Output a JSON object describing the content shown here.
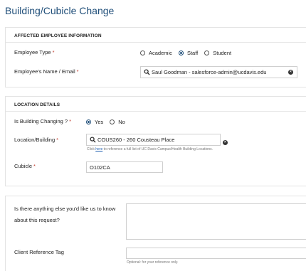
{
  "page": {
    "title": "Building/Cubicle Change"
  },
  "affected": {
    "heading": "AFFECTED EMPLOYEE INFORMATION",
    "employee_type": {
      "label": "Employee Type",
      "required": "*",
      "options": [
        "Academic",
        "Staff",
        "Student"
      ],
      "selected": "Staff"
    },
    "employee_name": {
      "label": "Employee's Name / Email",
      "required": "*",
      "value": "Saul Goodman - salesforce-admin@ucdavis.edu"
    }
  },
  "location": {
    "heading": "LOCATION DETAILS",
    "building_changing": {
      "label": "Is Building Changing ?",
      "required": "*",
      "options": [
        "Yes",
        "No"
      ],
      "selected": "Yes"
    },
    "location_building": {
      "label": "Location/Building",
      "required": "*",
      "value": "COUS260 - 260 Cousteau Place",
      "hint_prefix": "Click ",
      "hint_link": "here",
      "hint_suffix": " to reference a full list of UC Davis Campus/Health Building Locations."
    },
    "cubicle": {
      "label": "Cubicle",
      "required": "*",
      "value": "O102CA"
    }
  },
  "extra": {
    "anything_else": {
      "label_line1": "Is there anything else you'd like us to know",
      "label_line2": "about this request?"
    },
    "client_ref": {
      "label": "Client Reference Tag",
      "hint": "Optional: for your reference only."
    }
  },
  "colors": {
    "accent": "#1f4e79",
    "required": "#c0392b",
    "link": "#1f5fb0"
  }
}
